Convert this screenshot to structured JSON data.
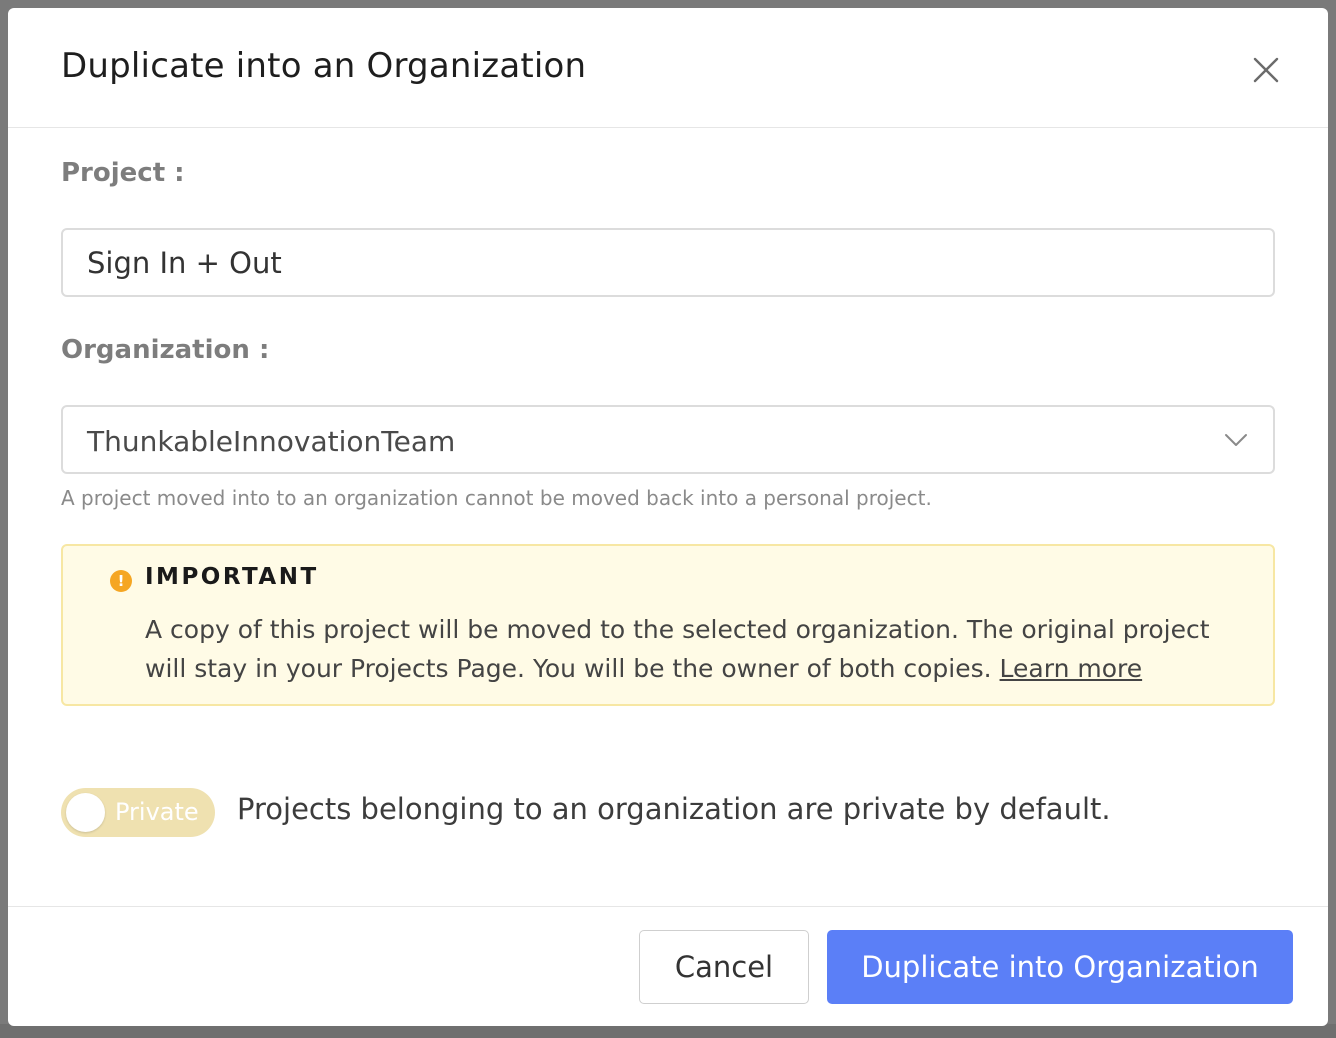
{
  "dialog": {
    "title": "Duplicate into an Organization",
    "close_icon": "close-icon"
  },
  "project": {
    "label": "Project :",
    "value": "Sign In + Out"
  },
  "organization": {
    "label": "Organization :",
    "selected": "ThunkableInnovationTeam",
    "helper": "A project moved into to an organization cannot be moved back into a personal project."
  },
  "notice": {
    "icon": "warning-icon",
    "icon_glyph": "!",
    "title": "IMPORTANT",
    "body": "A copy of this project will be moved to the selected organization. The original project will stay in your Projects Page. You will be the owner of both copies.",
    "link": "Learn more"
  },
  "privacy": {
    "toggle_label": "Private",
    "caption": "Projects belonging to an organization are private by default."
  },
  "footer": {
    "cancel": "Cancel",
    "confirm": "Duplicate into Organization"
  },
  "colors": {
    "primary": "#5b7ff7",
    "notice_bg": "#fffbe6",
    "notice_border": "#f7e7a3",
    "warning": "#f5a623",
    "toggle_bg": "#efe1b0"
  }
}
